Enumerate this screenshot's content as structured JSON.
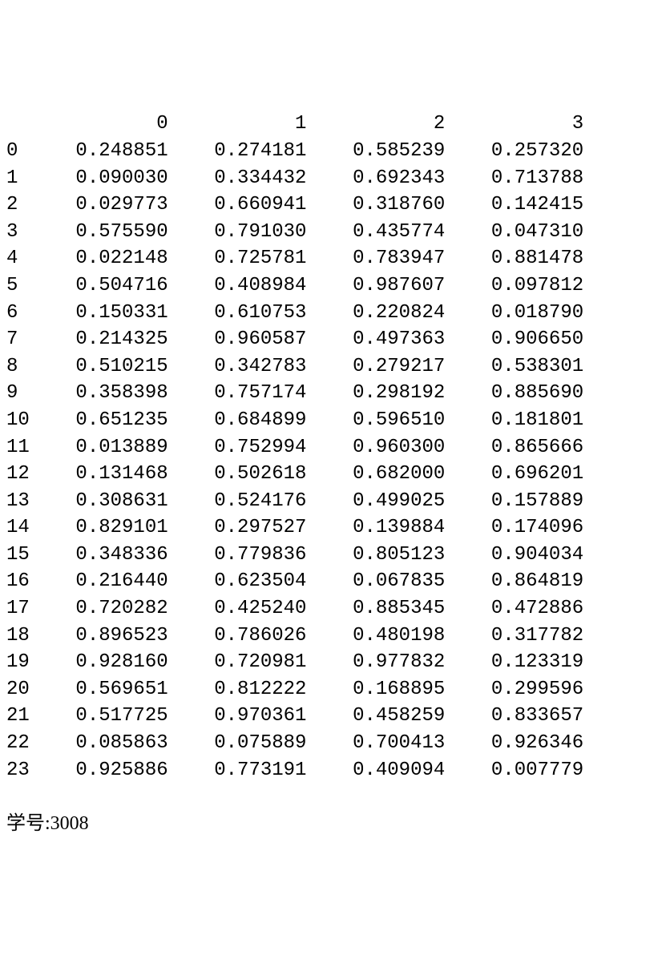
{
  "columns": [
    "0",
    "1",
    "2",
    "3"
  ],
  "rows": [
    {
      "idx": "0",
      "values": [
        "0.248851",
        "0.274181",
        "0.585239",
        "0.257320"
      ]
    },
    {
      "idx": "1",
      "values": [
        "0.090030",
        "0.334432",
        "0.692343",
        "0.713788"
      ]
    },
    {
      "idx": "2",
      "values": [
        "0.029773",
        "0.660941",
        "0.318760",
        "0.142415"
      ]
    },
    {
      "idx": "3",
      "values": [
        "0.575590",
        "0.791030",
        "0.435774",
        "0.047310"
      ]
    },
    {
      "idx": "4",
      "values": [
        "0.022148",
        "0.725781",
        "0.783947",
        "0.881478"
      ]
    },
    {
      "idx": "5",
      "values": [
        "0.504716",
        "0.408984",
        "0.987607",
        "0.097812"
      ]
    },
    {
      "idx": "6",
      "values": [
        "0.150331",
        "0.610753",
        "0.220824",
        "0.018790"
      ]
    },
    {
      "idx": "7",
      "values": [
        "0.214325",
        "0.960587",
        "0.497363",
        "0.906650"
      ]
    },
    {
      "idx": "8",
      "values": [
        "0.510215",
        "0.342783",
        "0.279217",
        "0.538301"
      ]
    },
    {
      "idx": "9",
      "values": [
        "0.358398",
        "0.757174",
        "0.298192",
        "0.885690"
      ]
    },
    {
      "idx": "10",
      "values": [
        "0.651235",
        "0.684899",
        "0.596510",
        "0.181801"
      ]
    },
    {
      "idx": "11",
      "values": [
        "0.013889",
        "0.752994",
        "0.960300",
        "0.865666"
      ]
    },
    {
      "idx": "12",
      "values": [
        "0.131468",
        "0.502618",
        "0.682000",
        "0.696201"
      ]
    },
    {
      "idx": "13",
      "values": [
        "0.308631",
        "0.524176",
        "0.499025",
        "0.157889"
      ]
    },
    {
      "idx": "14",
      "values": [
        "0.829101",
        "0.297527",
        "0.139884",
        "0.174096"
      ]
    },
    {
      "idx": "15",
      "values": [
        "0.348336",
        "0.779836",
        "0.805123",
        "0.904034"
      ]
    },
    {
      "idx": "16",
      "values": [
        "0.216440",
        "0.623504",
        "0.067835",
        "0.864819"
      ]
    },
    {
      "idx": "17",
      "values": [
        "0.720282",
        "0.425240",
        "0.885345",
        "0.472886"
      ]
    },
    {
      "idx": "18",
      "values": [
        "0.896523",
        "0.786026",
        "0.480198",
        "0.317782"
      ]
    },
    {
      "idx": "19",
      "values": [
        "0.928160",
        "0.720981",
        "0.977832",
        "0.123319"
      ]
    },
    {
      "idx": "20",
      "values": [
        "0.569651",
        "0.812222",
        "0.168895",
        "0.299596"
      ]
    },
    {
      "idx": "21",
      "values": [
        "0.517725",
        "0.970361",
        "0.458259",
        "0.833657"
      ]
    },
    {
      "idx": "22",
      "values": [
        "0.085863",
        "0.075889",
        "0.700413",
        "0.926346"
      ]
    },
    {
      "idx": "23",
      "values": [
        "0.925886",
        "0.773191",
        "0.409094",
        "0.007779"
      ]
    }
  ],
  "footer": {
    "label": "学号:3008"
  },
  "chart_data": {
    "type": "table",
    "columns": [
      "0",
      "1",
      "2",
      "3"
    ],
    "index": [
      0,
      1,
      2,
      3,
      4,
      5,
      6,
      7,
      8,
      9,
      10,
      11,
      12,
      13,
      14,
      15,
      16,
      17,
      18,
      19,
      20,
      21,
      22,
      23
    ],
    "data": [
      [
        0.248851,
        0.274181,
        0.585239,
        0.25732
      ],
      [
        0.09003,
        0.334432,
        0.692343,
        0.713788
      ],
      [
        0.029773,
        0.660941,
        0.31876,
        0.142415
      ],
      [
        0.57559,
        0.79103,
        0.435774,
        0.04731
      ],
      [
        0.022148,
        0.725781,
        0.783947,
        0.881478
      ],
      [
        0.504716,
        0.408984,
        0.987607,
        0.097812
      ],
      [
        0.150331,
        0.610753,
        0.220824,
        0.01879
      ],
      [
        0.214325,
        0.960587,
        0.497363,
        0.90665
      ],
      [
        0.510215,
        0.342783,
        0.279217,
        0.538301
      ],
      [
        0.358398,
        0.757174,
        0.298192,
        0.88569
      ],
      [
        0.651235,
        0.684899,
        0.59651,
        0.181801
      ],
      [
        0.013889,
        0.752994,
        0.9603,
        0.865666
      ],
      [
        0.131468,
        0.502618,
        0.682,
        0.696201
      ],
      [
        0.308631,
        0.524176,
        0.499025,
        0.157889
      ],
      [
        0.829101,
        0.297527,
        0.139884,
        0.174096
      ],
      [
        0.348336,
        0.779836,
        0.805123,
        0.904034
      ],
      [
        0.21644,
        0.623504,
        0.067835,
        0.864819
      ],
      [
        0.720282,
        0.42524,
        0.885345,
        0.472886
      ],
      [
        0.896523,
        0.786026,
        0.480198,
        0.317782
      ],
      [
        0.92816,
        0.720981,
        0.977832,
        0.123319
      ],
      [
        0.569651,
        0.812222,
        0.168895,
        0.299596
      ],
      [
        0.517725,
        0.970361,
        0.458259,
        0.833657
      ],
      [
        0.085863,
        0.075889,
        0.700413,
        0.926346
      ],
      [
        0.925886,
        0.773191,
        0.409094,
        0.007779
      ]
    ]
  }
}
